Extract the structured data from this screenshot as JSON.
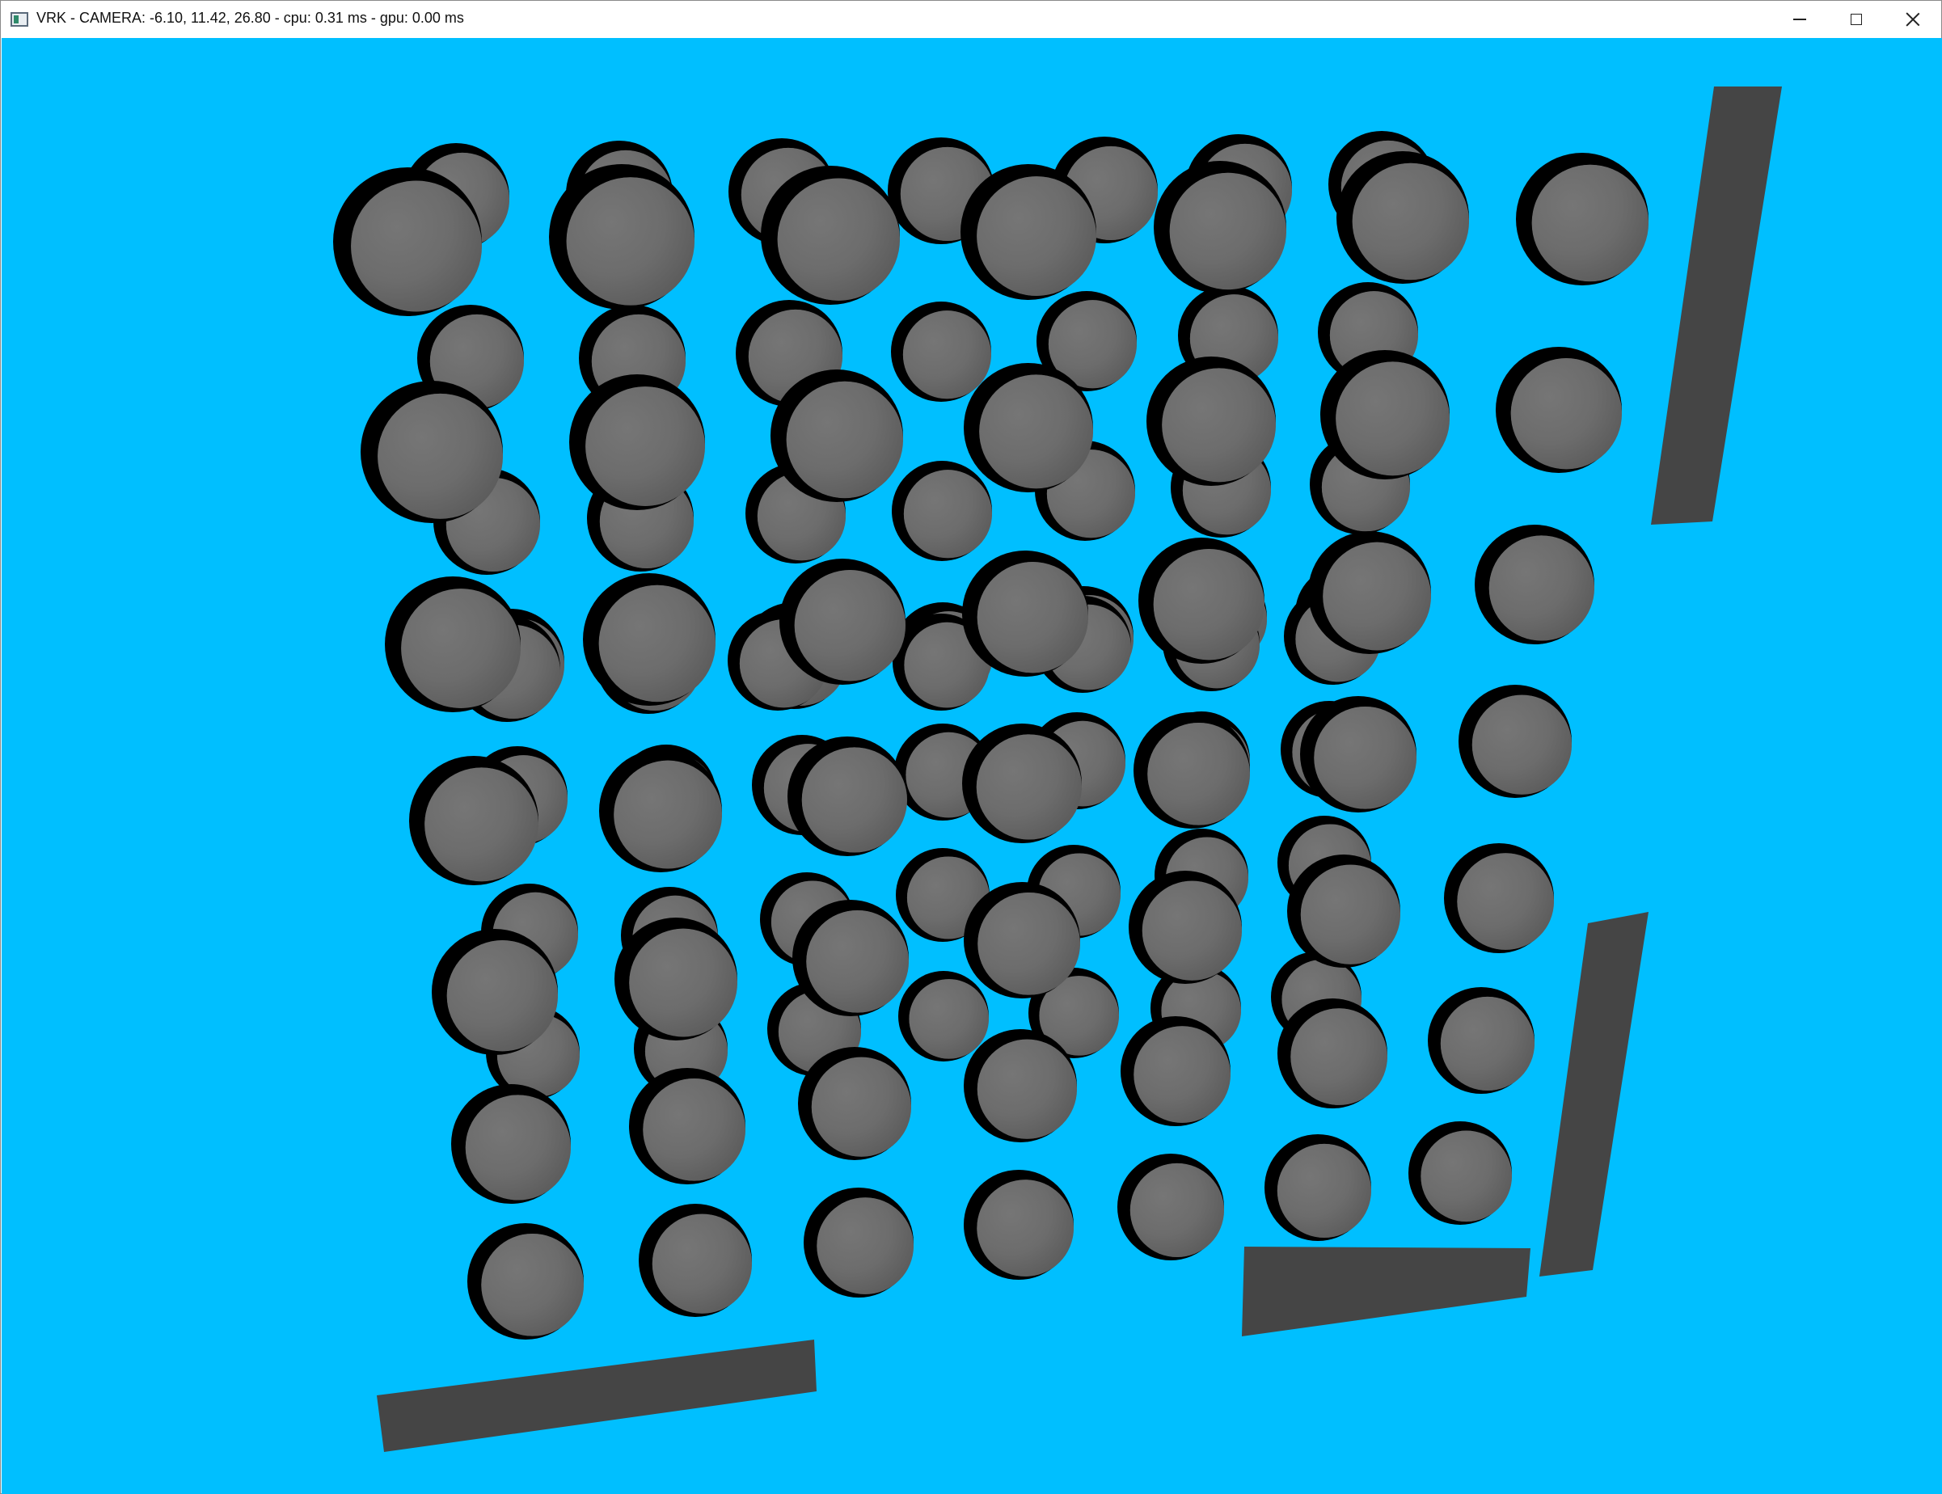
{
  "window": {
    "title": "VRK - CAMERA: -6.10, 11.42, 26.80 - cpu: 0.31 ms - gpu: 0.00 ms",
    "icon": "app-window-icon",
    "controls": {
      "minimize_icon": "minimize-icon",
      "maximize_icon": "maximize-icon",
      "close_icon": "close-icon"
    }
  },
  "scene": {
    "background_color": "#00bfff",
    "sphere_color": "#6e6e6e",
    "sphere_shadow_color": "#000000",
    "paddle_color": "#454545",
    "sphere_count": 108,
    "paddle_count": 4
  }
}
